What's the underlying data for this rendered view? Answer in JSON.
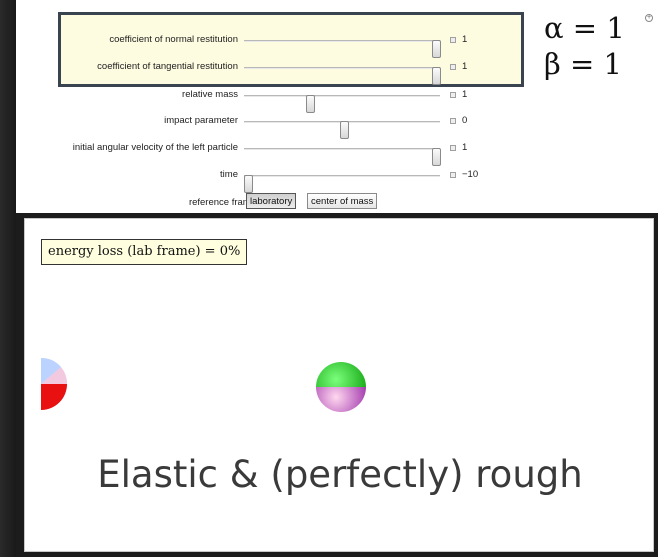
{
  "controls": {
    "sliders": [
      {
        "label": "coefficient of normal restitution",
        "value": "1",
        "level": 1.0
      },
      {
        "label": "coefficient of tangential restitution",
        "value": "1",
        "level": 1.0
      },
      {
        "label": "relative mass",
        "value": "1",
        "level": 0.33
      },
      {
        "label": "impact parameter",
        "value": "0",
        "level": 0.5
      },
      {
        "label": "initial angular velocity of the left particle",
        "value": "1",
        "level": 1.0
      },
      {
        "label": "time",
        "value": "−10",
        "level": 0.0
      }
    ],
    "reference_frame": {
      "label": "reference frame",
      "options": [
        "laboratory",
        "center of mass"
      ],
      "selected": "laboratory"
    }
  },
  "formula": {
    "alpha": "α = 1",
    "beta": "β = 1"
  },
  "plot": {
    "energy_loss": "energy loss (lab frame) = 0%",
    "caption": "Elastic & (perfectly) rough"
  },
  "colors": {
    "highlight_border": "#3a4350",
    "ball_green": "#18d818",
    "ball_red": "#e81010"
  }
}
